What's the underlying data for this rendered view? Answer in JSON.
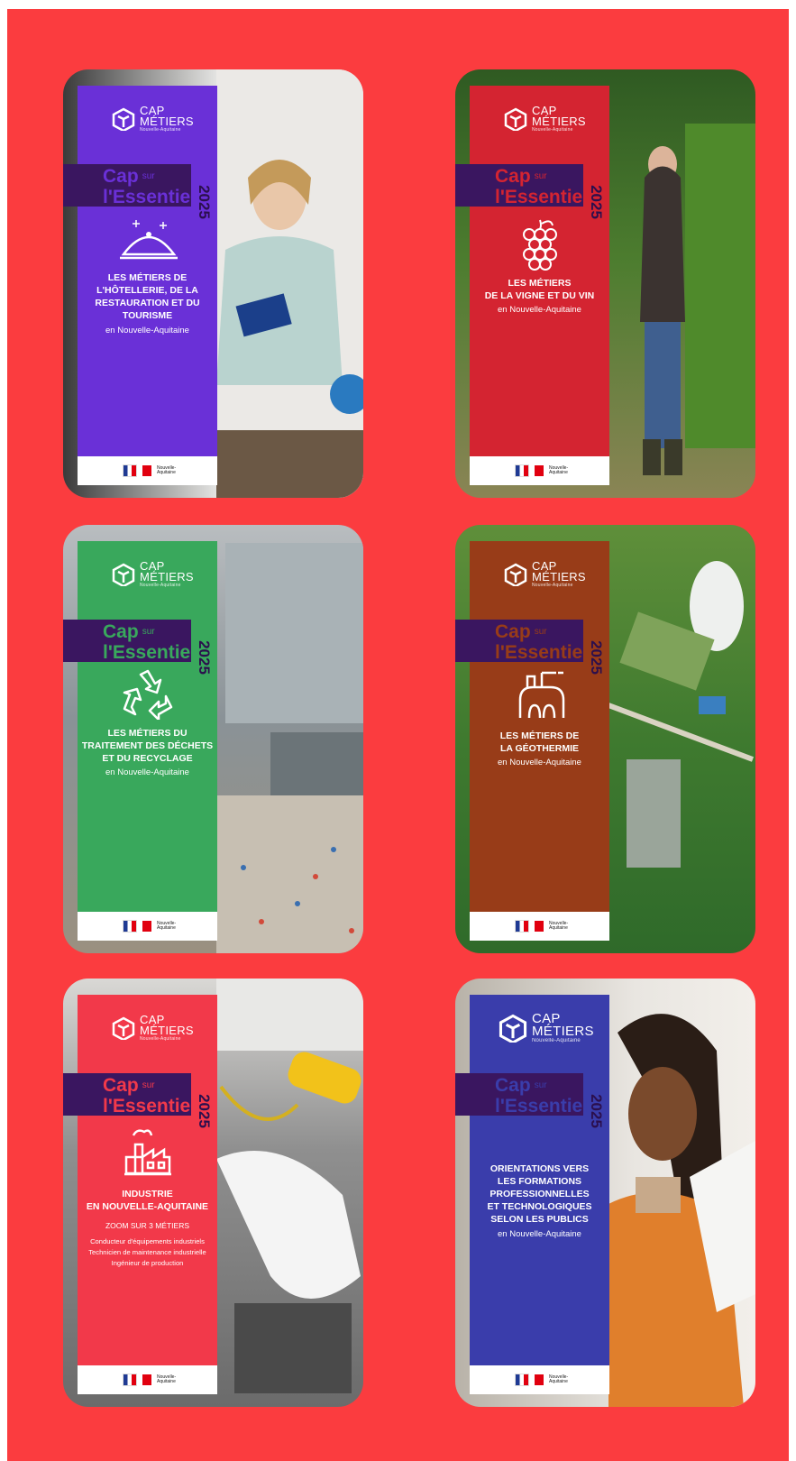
{
  "brand": {
    "name_line1": "CAP",
    "name_line2": "MÉTIERS",
    "tagline": "Nouvelle-Aquitaine"
  },
  "collection": {
    "cap": "Cap",
    "sur": "sur",
    "essentiel": "l'Essentiel",
    "year": "2025"
  },
  "footer": {
    "region_logo_text": "Nouvelle-Aquitaine"
  },
  "colors": {
    "page_background": "#fb3c3f",
    "header_box": "#3a1660"
  },
  "cards": [
    {
      "icon": "cloche-icon",
      "band_color": "#6a30d7",
      "title": [
        "LES MÉTIERS DE",
        "L'HÔTELLERIE, DE LA",
        "RESTAURATION ET DU",
        "TOURISME"
      ],
      "subtitle": "en Nouvelle-Aquitaine"
    },
    {
      "icon": "grapes-icon",
      "band_color": "#d42431",
      "title": [
        "LES MÉTIERS",
        "DE LA VIGNE ET DU VIN"
      ],
      "subtitle": "en Nouvelle-Aquitaine"
    },
    {
      "icon": "recycle-icon",
      "band_color": "#39a85c",
      "title": [
        "LES MÉTIERS DU",
        "TRAITEMENT DES DÉCHETS",
        "ET DU RECYCLAGE"
      ],
      "subtitle": "en Nouvelle-Aquitaine"
    },
    {
      "icon": "geothermal-plant-icon",
      "band_color": "#983c18",
      "title": [
        "LES MÉTIERS DE",
        "LA GÉOTHERMIE"
      ],
      "subtitle": "en Nouvelle-Aquitaine"
    },
    {
      "icon": "factory-icon",
      "band_color": "#f2394a",
      "title": [
        "INDUSTRIE",
        "EN NOUVELLE-AQUITAINE"
      ],
      "zoom": "ZOOM SUR 3 MÉTIERS",
      "jobs": [
        "Conducteur d'équipements industriels",
        "Technicien de maintenance industrielle",
        "Ingénieur de production"
      ]
    },
    {
      "icon": "",
      "band_color": "#3a3dab",
      "title": [
        "ORIENTATIONS VERS",
        "LES FORMATIONS",
        "PROFESSIONNELLES",
        "ET TECHNOLOGIQUES",
        "SELON LES PUBLICS"
      ],
      "subtitle": "en Nouvelle-Aquitaine"
    }
  ]
}
